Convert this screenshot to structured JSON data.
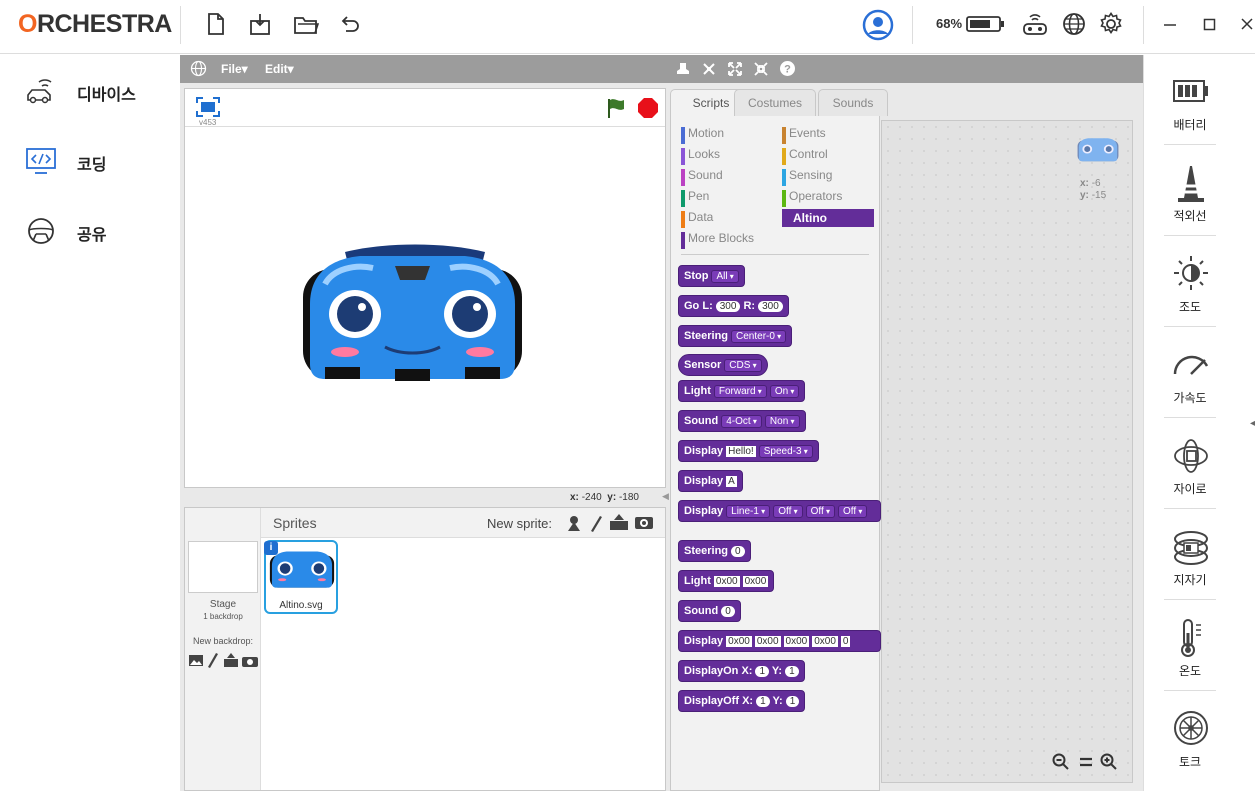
{
  "app": {
    "logo_o": "O",
    "logo_rest": "RCHESTRA",
    "battery_pct": "68%",
    "accent": "#f26522"
  },
  "sidebar": {
    "items": [
      {
        "label": "디바이스",
        "icon": "car-signal-icon"
      },
      {
        "label": "코딩",
        "icon": "code-monitor-icon"
      },
      {
        "label": "공유",
        "icon": "steering-wheel-icon"
      }
    ]
  },
  "menu": {
    "file": "File",
    "edit": "Edit"
  },
  "stage": {
    "version": "v453",
    "x_label": "x:",
    "x_val": "-240",
    "y_label": "y:",
    "y_val": "-180"
  },
  "sprites": {
    "title": "Sprites",
    "new_sprite": "New sprite:",
    "stage_label": "Stage",
    "stage_backdrops": "1 backdrop",
    "new_backdrop": "New backdrop:",
    "sprite_name": "Altino.svg"
  },
  "tabs": [
    "Scripts",
    "Costumes",
    "Sounds"
  ],
  "categories": {
    "left": [
      {
        "label": "Motion",
        "color": "#4a6cd4"
      },
      {
        "label": "Looks",
        "color": "#8a55d7"
      },
      {
        "label": "Sound",
        "color": "#bb42c3"
      },
      {
        "label": "Pen",
        "color": "#0e9a6c"
      },
      {
        "label": "Data",
        "color": "#ee7d16"
      },
      {
        "label": "More Blocks",
        "color": "#632d99"
      }
    ],
    "right": [
      {
        "label": "Events",
        "color": "#c88330"
      },
      {
        "label": "Control",
        "color": "#e1a91a"
      },
      {
        "label": "Sensing",
        "color": "#2ca5e2"
      },
      {
        "label": "Operators",
        "color": "#5cb712"
      },
      {
        "label": "Altino",
        "color": "#632d99"
      }
    ]
  },
  "blocks": {
    "stop": "Stop",
    "stop_opt": "All",
    "go": "Go",
    "go_l": "L:",
    "go_l_val": "300",
    "go_r": "R:",
    "go_r_val": "300",
    "steering": "Steering",
    "steering_opt": "Center-0",
    "sensor": "Sensor",
    "sensor_opt": "CDS",
    "light": "Light",
    "light_opt1": "Forward",
    "light_opt2": "On",
    "sound": "Sound",
    "sound_opt1": "4-Oct",
    "sound_opt2": "Non",
    "display": "Display",
    "display_txt": "Hello!",
    "display_opt": "Speed-3",
    "display2_txt": "A",
    "display3_opt1": "Line-1",
    "display3_opt2": "Off",
    "display3_opt3": "Off",
    "display3_opt4": "Off",
    "steering2_val": "0",
    "light2_v1": "0x00",
    "light2_v2": "0x00",
    "sound2_val": "0",
    "display4_vals": [
      "0x00",
      "0x00",
      "0x00",
      "0x00",
      "0"
    ],
    "displayon": "DisplayOn",
    "x": "X:",
    "y": "Y:",
    "one": "1",
    "displayoff": "DisplayOff"
  },
  "script_area": {
    "x_label": "x:",
    "x_val": "-6",
    "y_label": "y:",
    "y_val": "-15"
  },
  "right_panel": {
    "items": [
      {
        "label": "배터리",
        "icon": "battery-icon"
      },
      {
        "label": "적외선",
        "icon": "cone-icon"
      },
      {
        "label": "조도",
        "icon": "sun-icon"
      },
      {
        "label": "가속도",
        "icon": "speedometer-icon"
      },
      {
        "label": "자이로",
        "icon": "gyro-icon"
      },
      {
        "label": "지자기",
        "icon": "compass-ring-icon"
      },
      {
        "label": "온도",
        "icon": "thermometer-icon"
      },
      {
        "label": "토크",
        "icon": "wheel-icon"
      }
    ]
  }
}
